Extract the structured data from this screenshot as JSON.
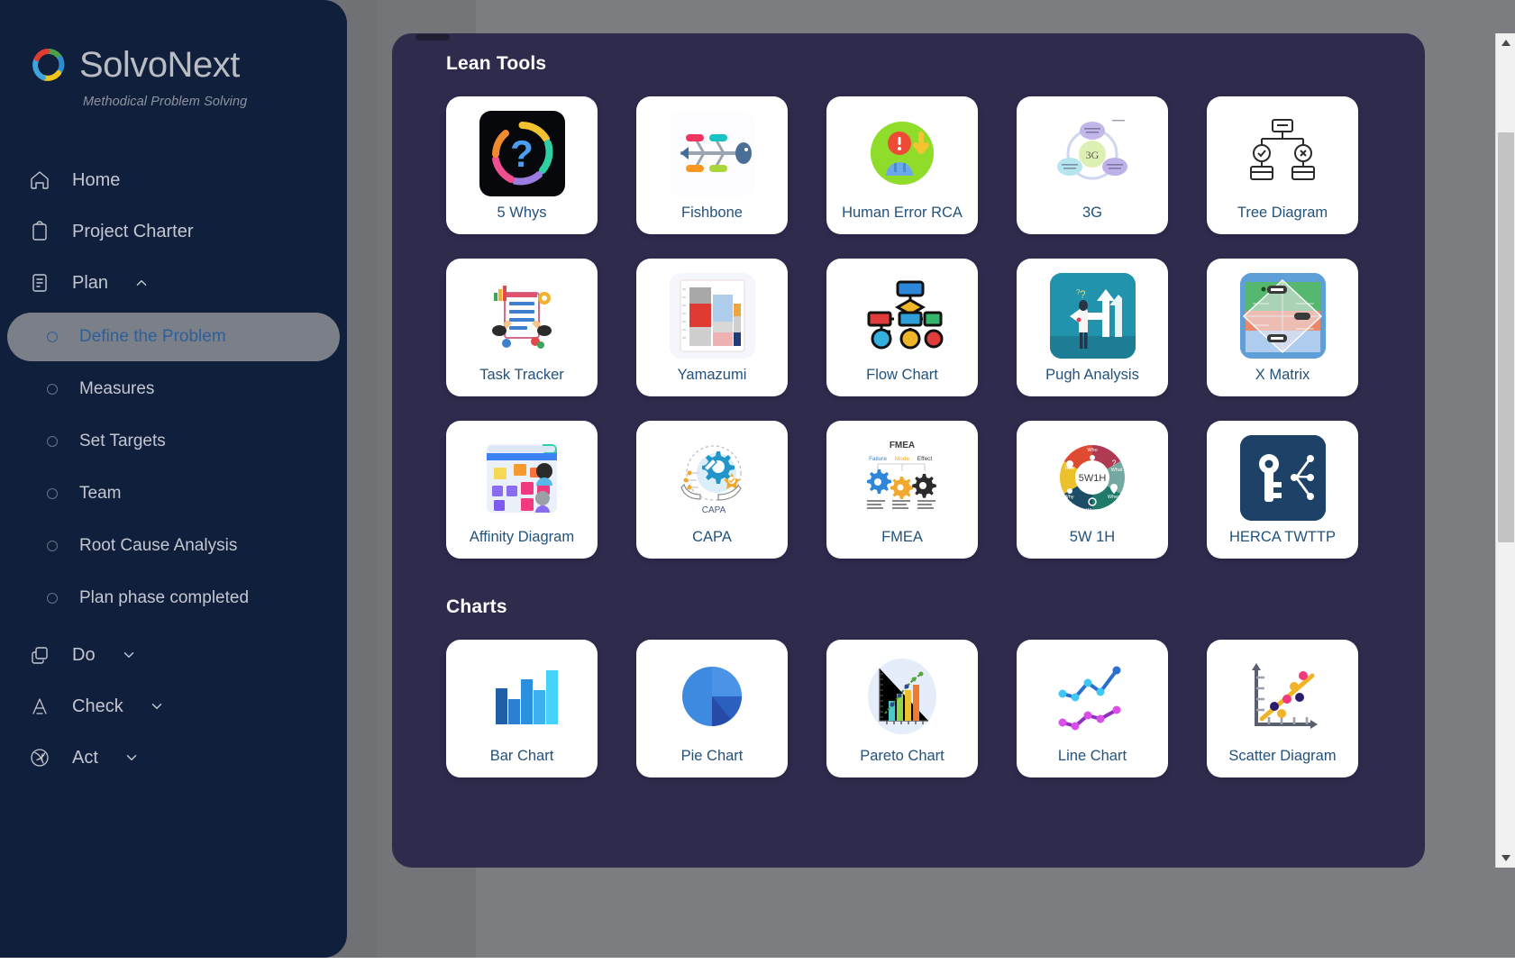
{
  "brand": {
    "name": "SolvoNext",
    "tagline": "Methodical Problem Solving",
    "logo_icon": "circular-ring-logo"
  },
  "sidebar": {
    "items": [
      {
        "label": "Home",
        "icon": "home-icon",
        "type": "link",
        "caret": ""
      },
      {
        "label": "Project Charter",
        "icon": "clipboard-icon",
        "type": "link",
        "caret": ""
      },
      {
        "label": "Plan",
        "icon": "document-lines-icon",
        "type": "group",
        "caret": "chevron-up-icon",
        "expanded": true
      }
    ],
    "plan_subitems": [
      {
        "label": "Define the Problem",
        "active": true
      },
      {
        "label": "Measures",
        "active": false
      },
      {
        "label": "Set Targets",
        "active": false
      },
      {
        "label": "Team",
        "active": false
      },
      {
        "label": "Root Cause Analysis",
        "active": false
      },
      {
        "label": "Plan phase completed",
        "active": false
      }
    ],
    "bottom_items": [
      {
        "label": "Do",
        "icon": "copy-icon",
        "caret": "chevron-down-icon"
      },
      {
        "label": "Check",
        "icon": "compass-a-icon",
        "caret": "chevron-down-icon"
      },
      {
        "label": "Act",
        "icon": "aperture-icon",
        "caret": "chevron-down-icon"
      }
    ]
  },
  "panel": {
    "sections": [
      {
        "title": "Lean Tools",
        "cards": [
          {
            "label": "5 Whys",
            "icon": "five-whys-question-mark-icon"
          },
          {
            "label": "Fishbone",
            "icon": "fishbone-diagram-icon"
          },
          {
            "label": "Human Error RCA",
            "icon": "human-error-person-icon"
          },
          {
            "label": "3G",
            "icon": "three-g-circles-icon"
          },
          {
            "label": "Tree Diagram",
            "icon": "tree-diagram-icon"
          },
          {
            "label": "Task Tracker",
            "icon": "task-tracker-checklist-icon"
          },
          {
            "label": "Yamazumi",
            "icon": "yamazumi-stacked-bar-icon"
          },
          {
            "label": "Flow Chart",
            "icon": "flow-chart-nodes-icon"
          },
          {
            "label": "Pugh Analysis",
            "icon": "pugh-analysis-arrows-icon"
          },
          {
            "label": "X Matrix",
            "icon": "x-matrix-icon"
          },
          {
            "label": "Affinity Diagram",
            "icon": "affinity-diagram-sticky-notes-icon"
          },
          {
            "label": "CAPA",
            "icon": "capa-gear-hands-icon"
          },
          {
            "label": "FMEA",
            "icon": "fmea-gears-icon"
          },
          {
            "label": "5W 1H",
            "icon": "5w1h-wheel-icon"
          },
          {
            "label": "HERCA TWTTP",
            "icon": "herca-key-icon"
          }
        ]
      },
      {
        "title": "Charts",
        "cards": [
          {
            "label": "Bar Chart",
            "icon": "bar-chart-icon"
          },
          {
            "label": "Pie Chart",
            "icon": "pie-chart-icon"
          },
          {
            "label": "Pareto Chart",
            "icon": "pareto-chart-icon"
          },
          {
            "label": "Line Chart",
            "icon": "line-chart-icon"
          },
          {
            "label": "Scatter Diagram",
            "icon": "scatter-diagram-icon"
          }
        ]
      }
    ]
  },
  "scrollbar": {
    "up_arrow": "triangle-up-icon",
    "down_arrow": "triangle-down-icon"
  },
  "colors": {
    "sidebar_bg": "#101f3c",
    "panel_bg": "#2e2b4d",
    "card_bg": "#ffffff",
    "card_label": "#23527c",
    "active_item_bg": "#7b7f88",
    "active_item_text": "#2f5f98",
    "backdrop": "#6f7174"
  }
}
